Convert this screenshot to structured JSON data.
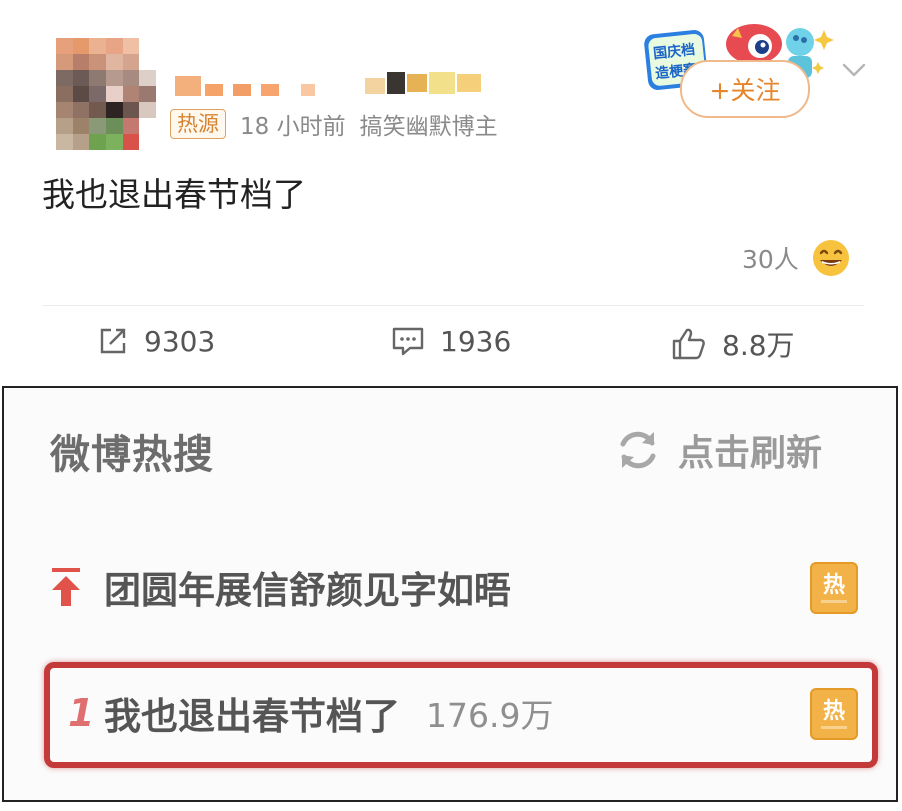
{
  "post": {
    "tag": "热源",
    "time": "18 小时前",
    "author_desc": "搞笑幽默博主",
    "badge_text": "国庆档\n造梗赛",
    "follow_label": "+关注",
    "text": "我也退出春节档了",
    "reaction_count": "30人",
    "actions": {
      "repost": "9303",
      "comment": "1936",
      "like": "8.8万"
    }
  },
  "hot_search": {
    "title": "微博热搜",
    "refresh_label": "点击刷新",
    "items": [
      {
        "rank": "pinned",
        "title": "团圆年展信舒颜见字如晤",
        "count": "",
        "badge": "热"
      },
      {
        "rank": "1",
        "title": "我也退出春节档了",
        "count": "176.9万",
        "badge": "热"
      }
    ]
  },
  "colors": {
    "accent_orange": "#e6852a",
    "hot_badge": "#f2b247",
    "highlight_red": "#c43a3a",
    "pinned_red": "#e0524a"
  },
  "icons": {
    "repost": "share-edit-icon",
    "comment": "comment-icon",
    "like": "thumbs-up-icon",
    "refresh": "refresh-icon",
    "pinned": "pin-top-icon",
    "more": "chevron-down-icon",
    "reaction": "grin-emoji-icon"
  }
}
